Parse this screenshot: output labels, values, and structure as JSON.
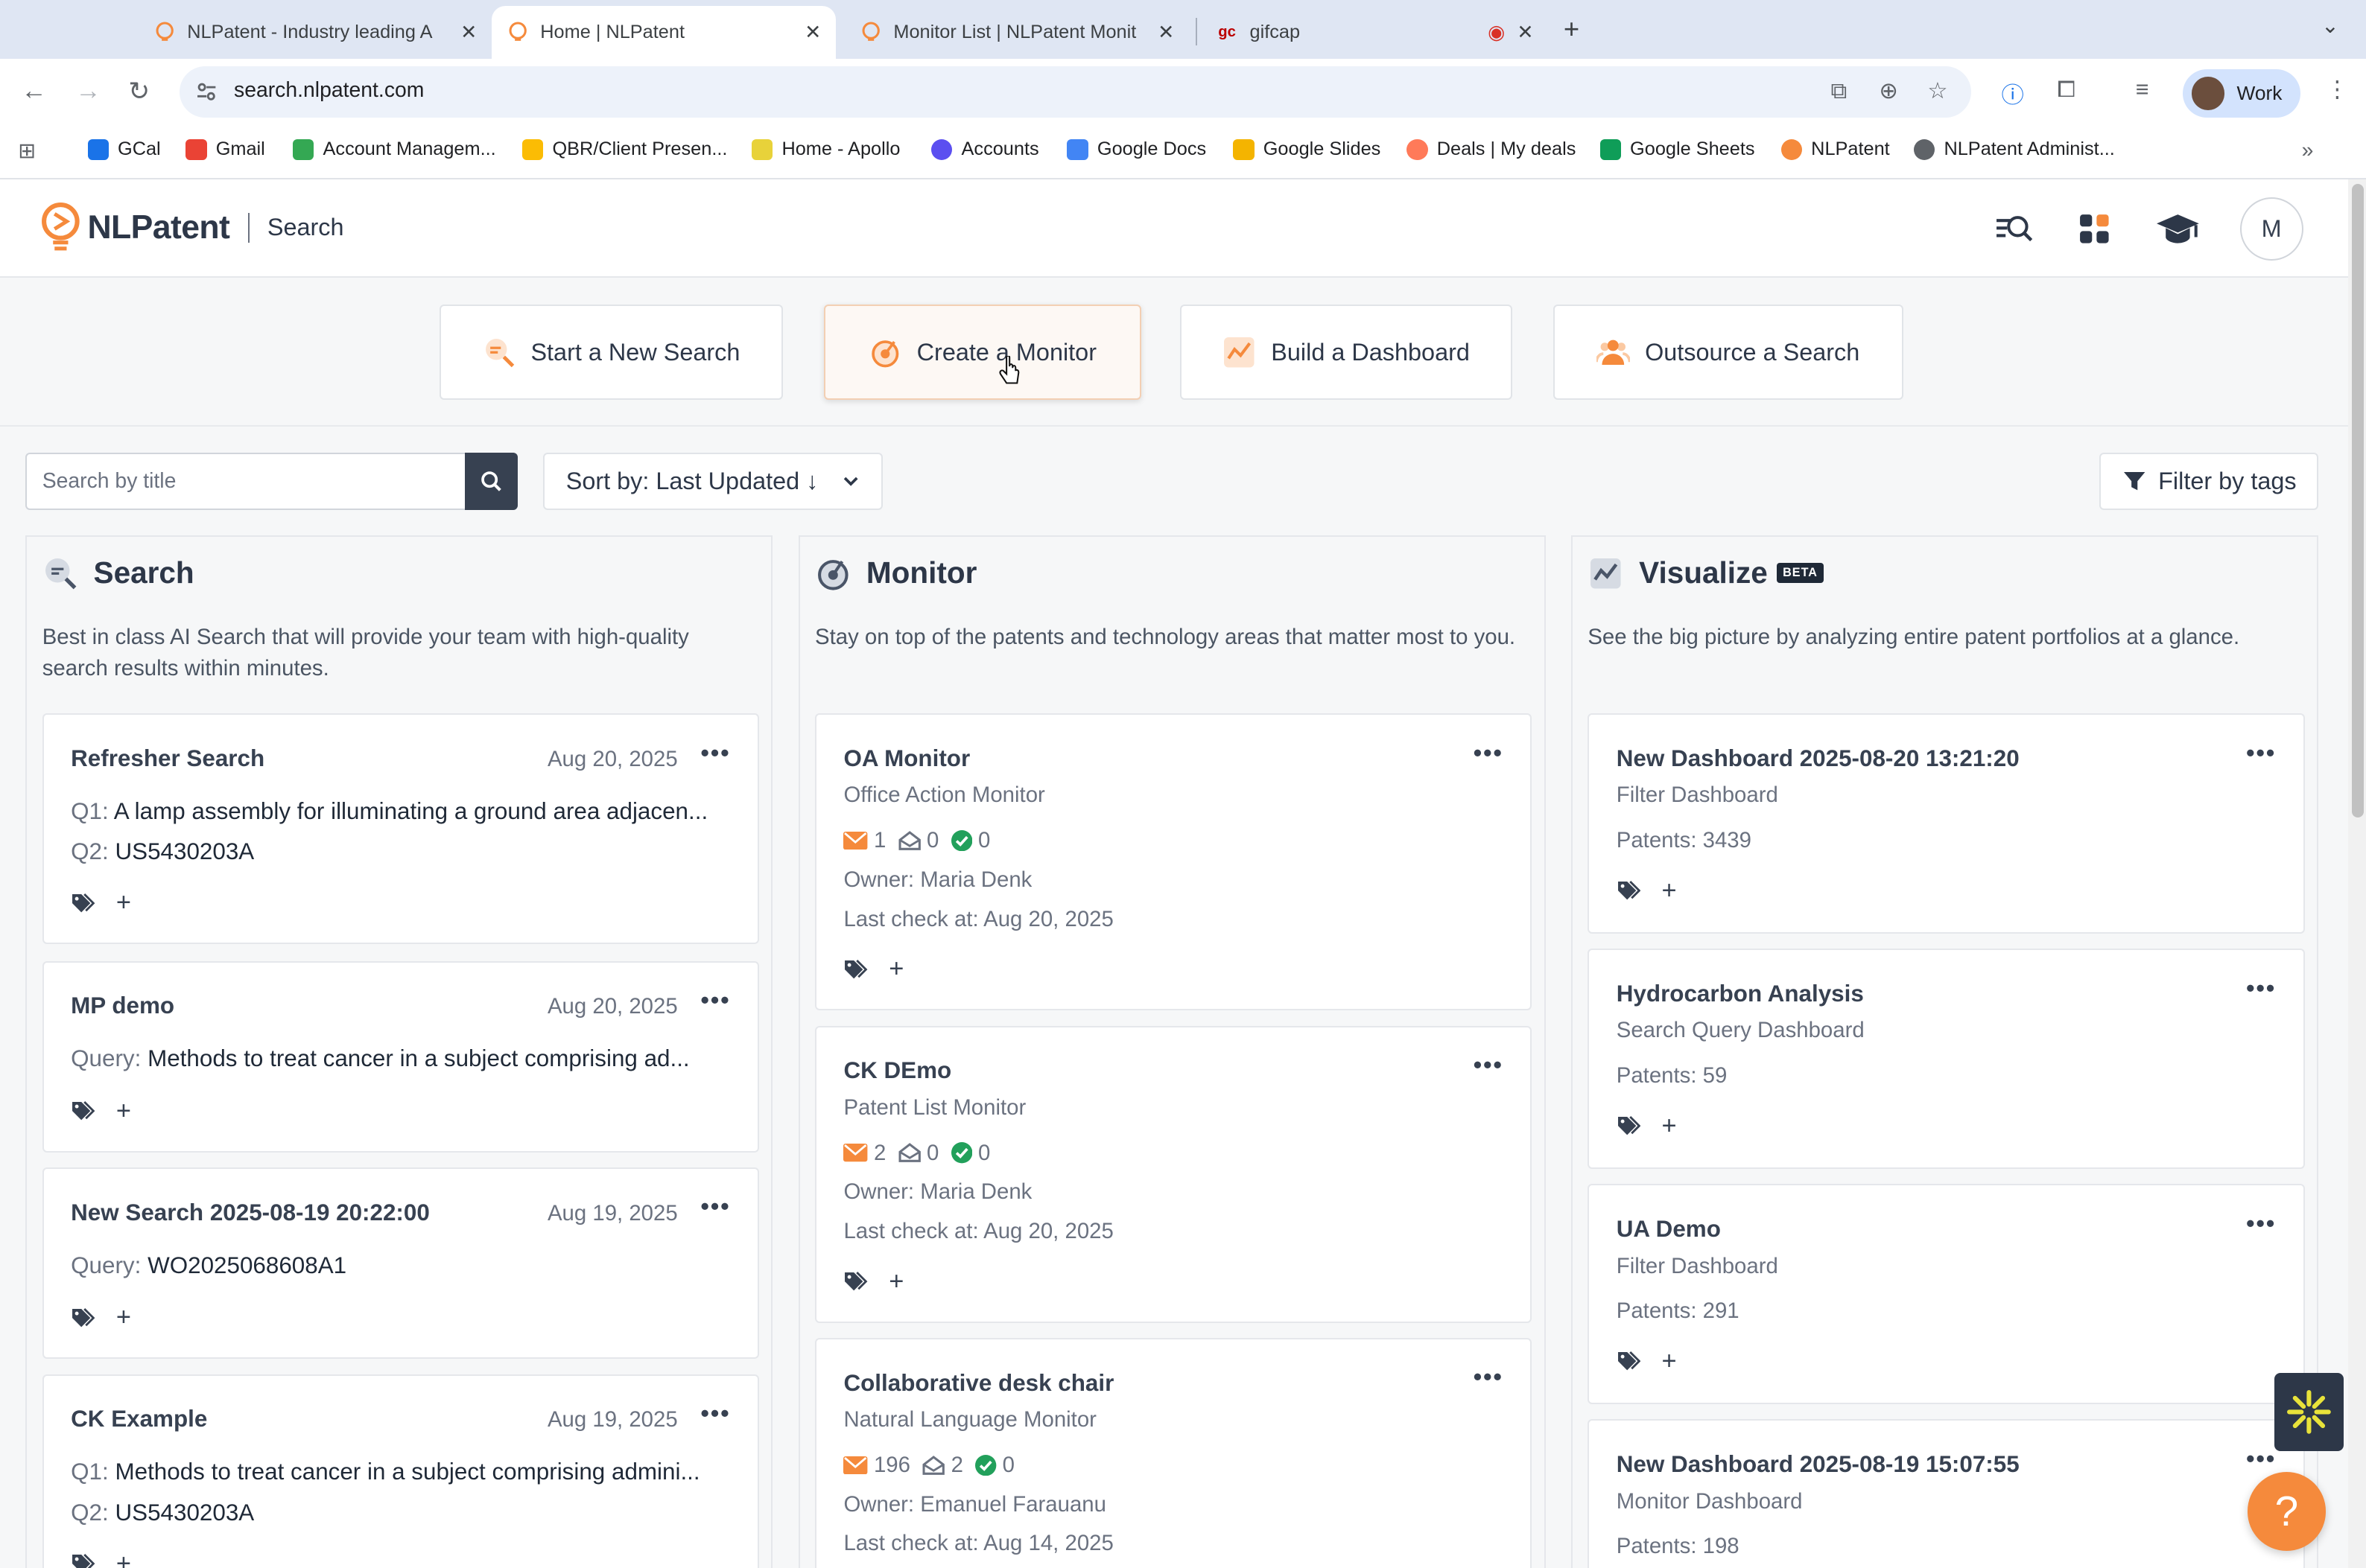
{
  "browser": {
    "tabs": [
      {
        "title": "NLPatent - Industry leading A",
        "active": false
      },
      {
        "title": "Home | NLPatent",
        "active": true
      },
      {
        "title": "Monitor List | NLPatent Monit",
        "active": false
      },
      {
        "title": "gifcap",
        "active": false
      }
    ],
    "url": "search.nlpatent.com",
    "profile": "Work",
    "bookmarks": [
      {
        "label": "GCal",
        "color": "#1a73e8"
      },
      {
        "label": "Gmail",
        "color": "#ea4335"
      },
      {
        "label": "Account Managem...",
        "color": "#34a853"
      },
      {
        "label": "QBR/Client Presen...",
        "color": "#fbbc04"
      },
      {
        "label": "Home - Apollo",
        "color": "#e8d23a"
      },
      {
        "label": "Accounts",
        "color": "#5b4ff0"
      },
      {
        "label": "Google Docs",
        "color": "#4285f4"
      },
      {
        "label": "Google Slides",
        "color": "#f4b400"
      },
      {
        "label": "Deals | My deals",
        "color": "#ff7a59"
      },
      {
        "label": "Google Sheets",
        "color": "#0f9d58"
      },
      {
        "label": "NLPatent",
        "color": "#f58a3c"
      },
      {
        "label": "NLPatent Administ...",
        "color": "#5f6368"
      }
    ]
  },
  "header": {
    "brand": "NLPatent",
    "section": "Search",
    "avatar_initial": "M"
  },
  "actions": [
    {
      "label": "Start a New Search",
      "icon": "search-magnify-icon"
    },
    {
      "label": "Create a Monitor",
      "icon": "monitor-target-icon"
    },
    {
      "label": "Build a Dashboard",
      "icon": "dashboard-chart-icon"
    },
    {
      "label": "Outsource a Search",
      "icon": "people-group-icon"
    }
  ],
  "toolbar": {
    "search_placeholder": "Search by title",
    "sort_label": "Sort by: Last Updated ↓",
    "filter_label": "Filter by tags"
  },
  "columns": {
    "search": {
      "title": "Search",
      "description": "Best in class AI Search that will provide your team with high-quality search results within minutes.",
      "cards": [
        {
          "title": "Refresher Search",
          "date": "Aug 20, 2025",
          "lines": [
            {
              "label": "Q1:",
              "text": "A lamp assembly for illuminating a ground area adjacen..."
            },
            {
              "label": "Q2:",
              "text": "US5430203A"
            }
          ]
        },
        {
          "title": "MP demo",
          "date": "Aug 20, 2025",
          "lines": [
            {
              "label": "Query:",
              "text": "Methods to treat cancer in a subject comprising ad..."
            }
          ]
        },
        {
          "title": "New Search 2025-08-19 20:22:00",
          "date": "Aug 19, 2025",
          "lines": [
            {
              "label": "Query:",
              "text": "WO2025068608A1"
            }
          ]
        },
        {
          "title": "CK Example",
          "date": "Aug 19, 2025",
          "lines": [
            {
              "label": "Q1:",
              "text": "Methods to treat cancer in a subject comprising admini..."
            },
            {
              "label": "Q2:",
              "text": "US5430203A"
            }
          ]
        }
      ]
    },
    "monitor": {
      "title": "Monitor",
      "description": "Stay on top of the patents and technology areas that matter most to you.",
      "cards": [
        {
          "title": "OA Monitor",
          "type": "Office Action Monitor",
          "new": "1",
          "read": "0",
          "done": "0",
          "owner": "Owner: Maria Denk",
          "last_check": "Last check at: Aug 20, 2025"
        },
        {
          "title": "CK DEmo",
          "type": "Patent List Monitor",
          "new": "2",
          "read": "0",
          "done": "0",
          "owner": "Owner: Maria Denk",
          "last_check": "Last check at: Aug 20, 2025"
        },
        {
          "title": "Collaborative desk chair",
          "type": "Natural Language Monitor",
          "new": "196",
          "read": "2",
          "done": "0",
          "owner": "Owner: Emanuel Farauanu",
          "last_check": "Last check at: Aug 14, 2025"
        }
      ]
    },
    "visualize": {
      "title": "Visualize",
      "badge": "BETA",
      "description": "See the big picture by analyzing entire patent portfolios at a glance.",
      "cards": [
        {
          "title": "New Dashboard 2025-08-20 13:21:20",
          "type": "Filter Dashboard",
          "patents": "Patents: 3439"
        },
        {
          "title": "Hydrocarbon Analysis",
          "type": "Search Query Dashboard",
          "patents": "Patents: 59"
        },
        {
          "title": "UA Demo",
          "type": "Filter Dashboard",
          "patents": "Patents: 291"
        },
        {
          "title": "New Dashboard 2025-08-19 15:07:55",
          "type": "Monitor Dashboard",
          "patents": "Patents: 198"
        }
      ]
    }
  },
  "colors": {
    "brand_orange": "#f58a3c",
    "text_dark": "#2d3748",
    "status_green": "#22a05b"
  },
  "icons": {
    "tag": "tag-icon",
    "more": "more-dots-icon",
    "mail": "mail-icon",
    "inbox": "inbox-open-icon",
    "check": "check-circle-icon"
  }
}
